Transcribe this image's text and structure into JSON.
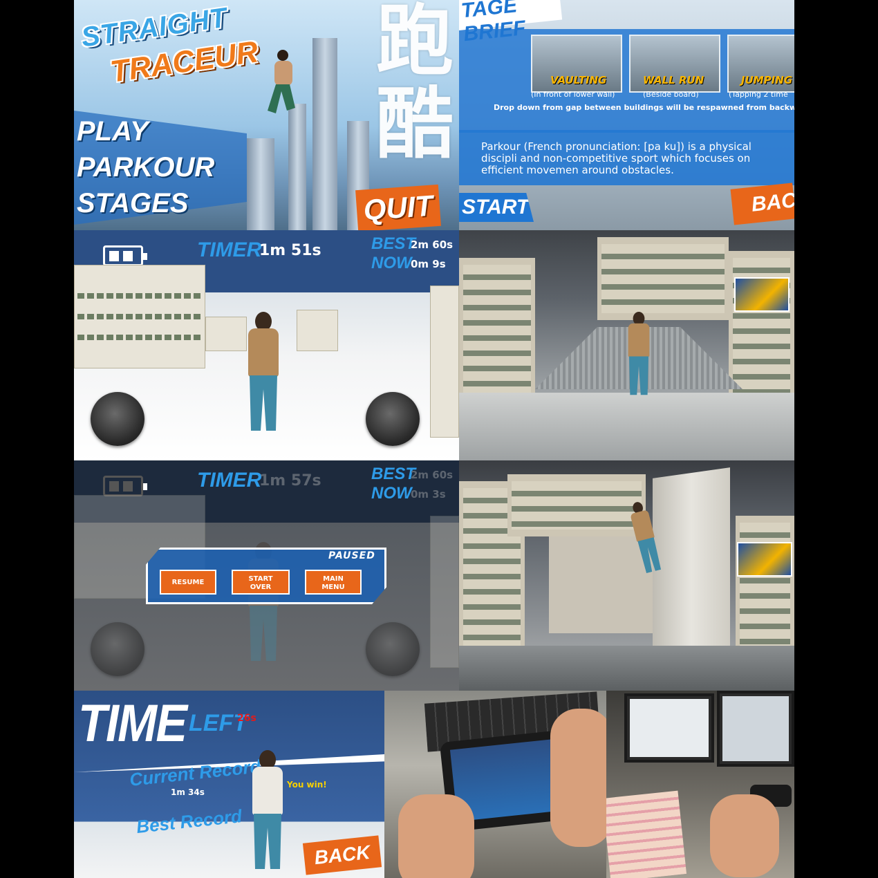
{
  "title_screen": {
    "title_line1": "STRAIGHT",
    "title_line2": "TRACEUR",
    "cjk_title": "跑酷",
    "menu": [
      "PLAY",
      "PARKOUR",
      "STAGES"
    ],
    "quit_label": "QUIT"
  },
  "stage_brief": {
    "header": "TAGE BRIEF",
    "moves": [
      {
        "name": "VAULTING",
        "hint": "(In front of lower wall)"
      },
      {
        "name": "WALL RUN",
        "hint": "(Beside board)"
      },
      {
        "name": "JUMPING",
        "hint": "(Tapping 2 time"
      }
    ],
    "note": "Drop down from gap between buildings will be respawned from backward pos",
    "quote": "Parkour (French pronunciation: [pa ku]) is a physical discipli and non-competitive sport which focuses on efficient movemen around obstacles.",
    "start_label": "START",
    "back_label": "BAC"
  },
  "gameplay": {
    "timer_label": "TIMER",
    "timer_value": "1m 51s",
    "best_label": "BEST",
    "best_value": "2m 60s",
    "now_label": "NOW",
    "now_value": "0m 9s"
  },
  "paused": {
    "timer_label": "TIMER",
    "timer_value": "1m 57s",
    "best_label": "BEST",
    "best_value": "2m 60s",
    "now_label": "NOW",
    "now_value": "0m 3s",
    "dialog_title": "PAUSED",
    "buttons": [
      "RESUME",
      "START OVER",
      "MAIN MENU"
    ]
  },
  "result": {
    "time_label": "TIME",
    "left_label": "LEFT",
    "seconds_left": "26s",
    "current_record_label": "Current Record",
    "current_record_value": "1m 34s",
    "win_text": "You win!",
    "best_record_label": "Best Record",
    "back_label": "BACK"
  },
  "colors": {
    "accent_blue": "#2e9be8",
    "hud_blue": "#2c4f85",
    "button_orange": "#e8661a",
    "title_orange": "#f07a1a"
  }
}
